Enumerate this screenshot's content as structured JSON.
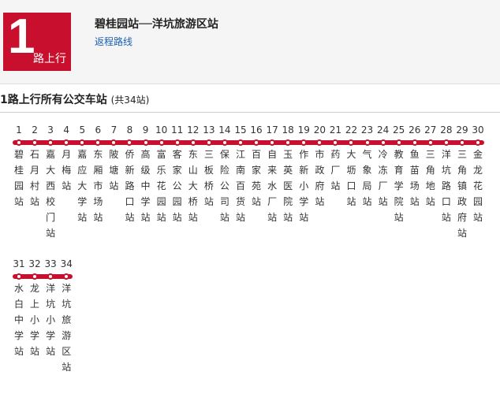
{
  "header": {
    "route_number": "1",
    "direction": "路上行",
    "title": "碧桂园站──洋坑旅游区站",
    "return_link": "返程路线"
  },
  "section": {
    "title": "1路上行所有公交车站",
    "count": "(共34站)"
  },
  "accent_color": "#c8102e",
  "stops": [
    {
      "num": "1",
      "name": "碧桂园站"
    },
    {
      "num": "2",
      "name": "石月村站"
    },
    {
      "num": "3",
      "name": "嘉大西校门站"
    },
    {
      "num": "4",
      "name": "月梅站"
    },
    {
      "num": "5",
      "name": "嘉应大学站"
    },
    {
      "num": "6",
      "name": "东厢市场站"
    },
    {
      "num": "7",
      "name": "陂塘站"
    },
    {
      "num": "8",
      "name": "侨新路口站"
    },
    {
      "num": "9",
      "name": "高级中学站"
    },
    {
      "num": "10",
      "name": "富乐花园站"
    },
    {
      "num": "11",
      "name": "客家公园站"
    },
    {
      "num": "12",
      "name": "东山大桥站"
    },
    {
      "num": "13",
      "name": "三板桥站"
    },
    {
      "num": "14",
      "name": "保险公司站"
    },
    {
      "num": "15",
      "name": "江南百货站"
    },
    {
      "num": "16",
      "name": "百家苑站"
    },
    {
      "num": "17",
      "name": "自来水厂站"
    },
    {
      "num": "18",
      "name": "玉英医院站"
    },
    {
      "num": "19",
      "name": "作新小学站"
    },
    {
      "num": "20",
      "name": "市政府站"
    },
    {
      "num": "21",
      "name": "药厂站"
    },
    {
      "num": "22",
      "name": "大坜口站"
    },
    {
      "num": "23",
      "name": "气象局站"
    },
    {
      "num": "24",
      "name": "冷冻厂站"
    },
    {
      "num": "25",
      "name": "教育学院站"
    },
    {
      "num": "26",
      "name": "鱼苗场站"
    },
    {
      "num": "27",
      "name": "三角地站"
    },
    {
      "num": "28",
      "name": "洋坑路口站"
    },
    {
      "num": "29",
      "name": "三角镇政府站"
    },
    {
      "num": "30",
      "name": "金龙花园站"
    },
    {
      "num": "31",
      "name": "水白中学站"
    },
    {
      "num": "32",
      "name": "龙上小学站"
    },
    {
      "num": "33",
      "name": "洋坑小学站"
    },
    {
      "num": "34",
      "name": "洋坑旅游区站"
    }
  ]
}
